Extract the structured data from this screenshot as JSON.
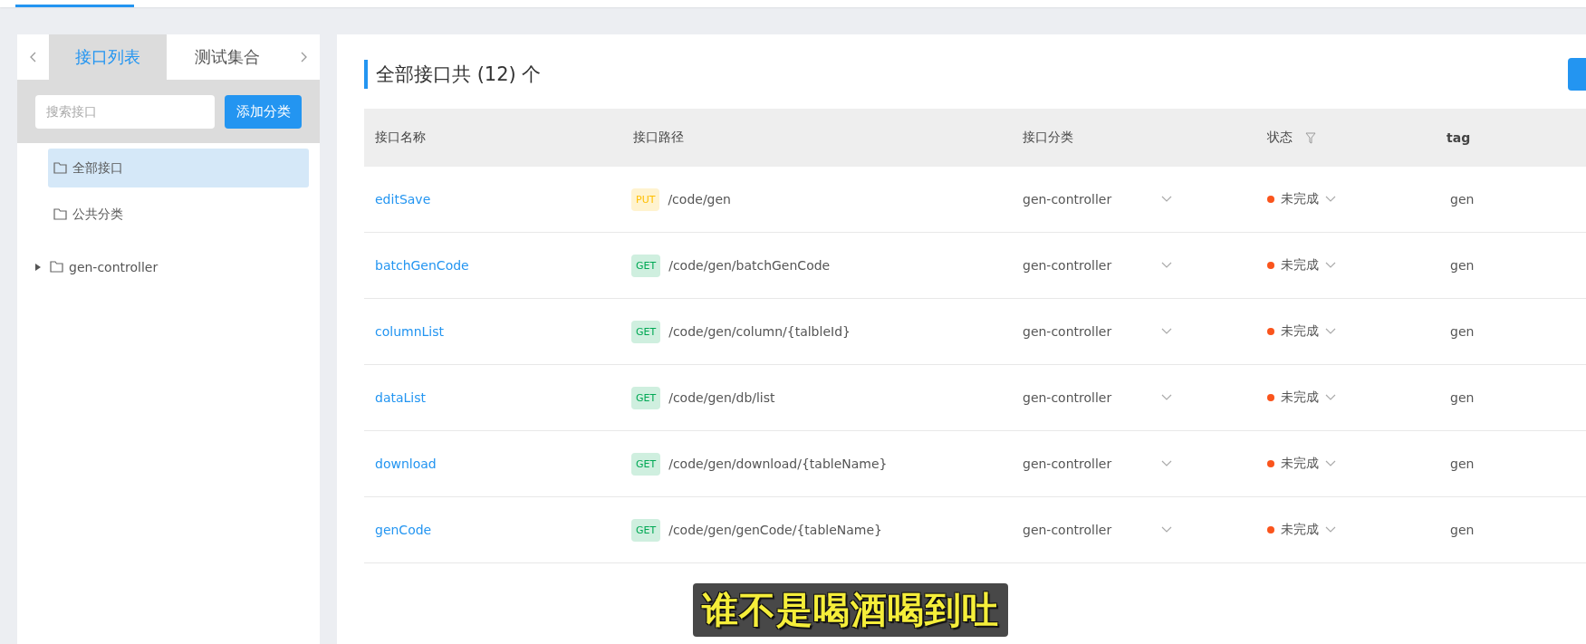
{
  "sidebar": {
    "tabs": [
      {
        "label": "接口列表",
        "selected": true
      },
      {
        "label": "测试集合",
        "selected": false
      }
    ],
    "search": {
      "placeholder": "搜索接口"
    },
    "add_button": "添加分类",
    "tree": [
      {
        "label": "全部接口",
        "selected": true,
        "kind": "leaf"
      },
      {
        "label": "公共分类",
        "selected": false,
        "kind": "leaf"
      },
      {
        "label": "gen-controller",
        "selected": false,
        "kind": "group",
        "expanded": false
      }
    ]
  },
  "main": {
    "title": "全部接口共 (12) 个",
    "table": {
      "columns": [
        "接口名称",
        "接口路径",
        "接口分类",
        "状态",
        "tag"
      ],
      "rows": [
        {
          "name": "editSave",
          "method": "PUT",
          "path": "/code/gen",
          "category": "gen-controller",
          "status": "未完成",
          "color": "#fa541c",
          "tag": "gen"
        },
        {
          "name": "batchGenCode",
          "method": "GET",
          "path": "/code/gen/batchGenCode",
          "category": "gen-controller",
          "status": "未完成",
          "color": "#fa541c",
          "tag": "gen"
        },
        {
          "name": "columnList",
          "method": "GET",
          "path": "/code/gen/column/{talbleId}",
          "category": "gen-controller",
          "status": "未完成",
          "color": "#fa541c",
          "tag": "gen"
        },
        {
          "name": "dataList",
          "method": "GET",
          "path": "/code/gen/db/list",
          "category": "gen-controller",
          "status": "未完成",
          "color": "#fa541c",
          "tag": "gen"
        },
        {
          "name": "download",
          "method": "GET",
          "path": "/code/gen/download/{tableName}",
          "category": "gen-controller",
          "status": "未完成",
          "color": "#fa541c",
          "tag": "gen"
        },
        {
          "name": "genCode",
          "method": "GET",
          "path": "/code/gen/genCode/{tableName}",
          "category": "gen-controller",
          "status": "未完成",
          "color": "#fa541c",
          "tag": "gen"
        }
      ]
    }
  },
  "caption": "谁不是喝酒喝到吐"
}
